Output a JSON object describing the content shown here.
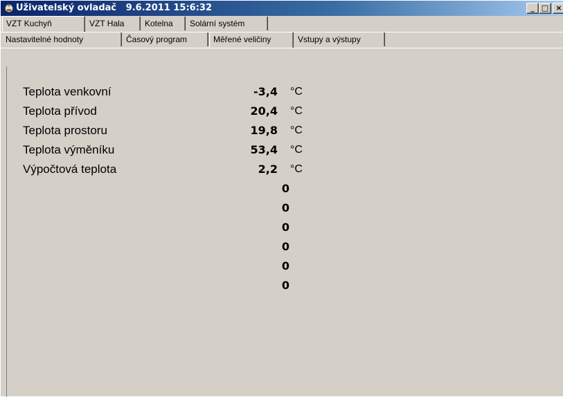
{
  "window": {
    "title": "Uživatelský ovladač   9.6.2011 15:6:32",
    "controls": {
      "minimize": "_",
      "maximize": "□",
      "close": "×"
    }
  },
  "tabs_main": [
    {
      "label": "VZT Kuchyň",
      "active": true
    },
    {
      "label": "VZT Hala",
      "active": false
    },
    {
      "label": "Kotelna",
      "active": false
    },
    {
      "label": "Solární systém",
      "active": false
    }
  ],
  "tabs_sub": [
    {
      "label": "Nastavitelné hodnoty",
      "active": false
    },
    {
      "label": "Časový program",
      "active": false
    },
    {
      "label": "Měřené veličiny",
      "active": true
    },
    {
      "label": "Vstupy a výstupy",
      "active": false
    }
  ],
  "measurements": [
    {
      "label": "Teplota venkovní",
      "value": "-3,4",
      "unit": "°C"
    },
    {
      "label": "Teplota přívod",
      "value": "20,4",
      "unit": "°C"
    },
    {
      "label": "Teplota prostoru",
      "value": "19,8",
      "unit": "°C"
    },
    {
      "label": "Teplota výměníku",
      "value": "53,4",
      "unit": "°C"
    },
    {
      "label": "Výpočtová teplota",
      "value": "2,2",
      "unit": "°C"
    },
    {
      "label": "",
      "value": "0",
      "unit": ""
    },
    {
      "label": "",
      "value": "0",
      "unit": ""
    },
    {
      "label": "",
      "value": "0",
      "unit": ""
    },
    {
      "label": "",
      "value": "0",
      "unit": ""
    },
    {
      "label": "",
      "value": "0",
      "unit": ""
    },
    {
      "label": "",
      "value": "0",
      "unit": ""
    }
  ],
  "icons": {
    "app": "app-icon",
    "colors": {
      "titlebar_start": "#0a246a",
      "titlebar_end": "#a6caf0",
      "face": "#d4d0c8"
    }
  }
}
